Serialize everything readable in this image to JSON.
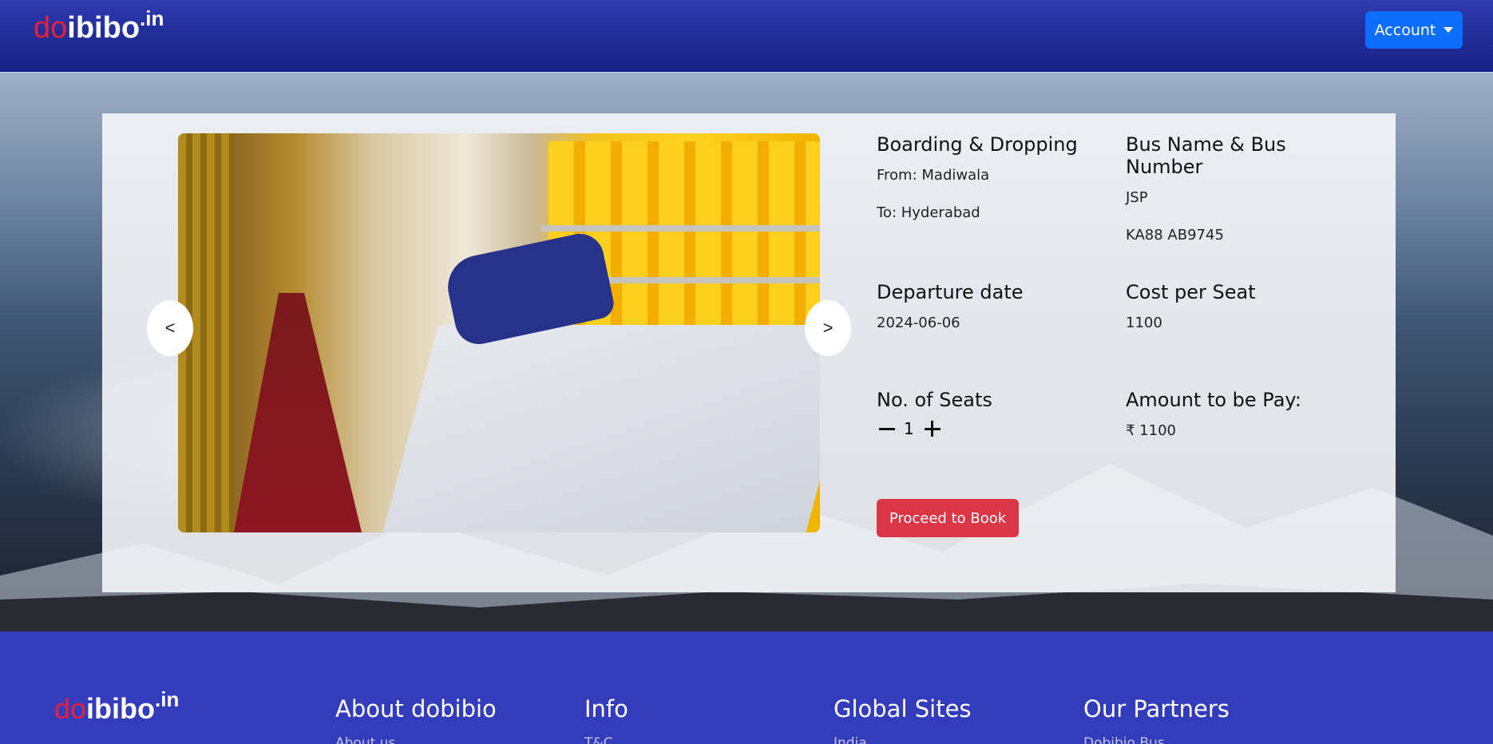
{
  "navbar": {
    "brand": {
      "do": "do",
      "ibibo": "ibibo",
      "suffix": ".in"
    },
    "account_label": "Account"
  },
  "carousel": {
    "prev_label": "<",
    "next_label": ">"
  },
  "details": {
    "boarding": {
      "heading": "Boarding & Dropping",
      "from": "From: Madiwala",
      "to": "To: Hyderabad"
    },
    "bus": {
      "heading": "Bus Name & Bus Number",
      "name": "JSP",
      "number": "KA88 AB9745"
    },
    "departure": {
      "heading": "Departure date",
      "date": "2024-06-06"
    },
    "cost": {
      "heading": "Cost per Seat",
      "value": "1100"
    },
    "seats": {
      "heading": "No. of Seats",
      "count": "1"
    },
    "amount": {
      "heading": "Amount to be Pay:",
      "value": "₹ 1100"
    }
  },
  "book_label": "Proceed to Book",
  "footer": {
    "brand": {
      "do": "do",
      "ibibo": "ibibo",
      "suffix": ".in"
    },
    "columns": [
      {
        "title": "About dobibio",
        "link": "About us"
      },
      {
        "title": "Info",
        "link": "T&C"
      },
      {
        "title": "Global Sites",
        "link": "India"
      },
      {
        "title": "Our Partners",
        "link": "Dobibio Bus"
      }
    ]
  },
  "colors": {
    "nav_bg": "#1f2a93",
    "footer_bg": "#333cba",
    "brand_red": "#e8203c",
    "primary": "#0d6efd",
    "danger": "#dc3545"
  }
}
